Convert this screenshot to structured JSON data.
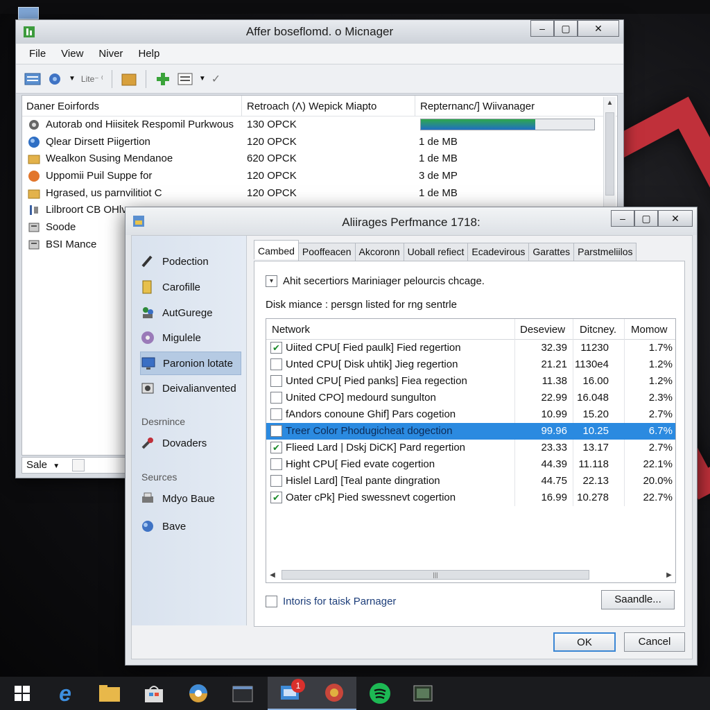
{
  "colors": {
    "accent": "#2b8ae0",
    "check": "#1b8a2a",
    "brand_red": "#c0303a",
    "taskbar": "#1a1b1e"
  },
  "main_window": {
    "title": "Affer boseflomd. o Micnager",
    "menu": [
      "File",
      "View",
      "Niver",
      "Help"
    ],
    "toolbar": {
      "text": "Lite⁻ ⁽"
    },
    "columns": [
      "Daner Eoirfords",
      "Retroach (Λ)  Wepick Miapto",
      "Repternanc/] Wiivanager"
    ],
    "rows": [
      {
        "icon": "gear-icon",
        "name": "Autorab ond Hiisitek Respomil Purkwous",
        "c2": "130 OPCK",
        "meter": 0.66
      },
      {
        "icon": "globe-icon",
        "name": "Qlear Dirsett Piigertion",
        "c2": "120 OPCK",
        "c3": "1 de MB"
      },
      {
        "icon": "folder-icon",
        "name": "Wealkon Susing Mendanoe",
        "c2": "620 OPCK",
        "c3": "1 de MB"
      },
      {
        "icon": "orange-circle-icon",
        "name": "Uppomii Puil Suppe for",
        "c2": "120 OPCK",
        "c3": "3 de MP"
      },
      {
        "icon": "folder-icon",
        "name": "Hgrased, us parnvilitiot C",
        "c2": "120 OPCK",
        "c3": "1 de MB"
      },
      {
        "icon": "tools-icon",
        "name": "Lilbroort CB OHlve",
        "c2": "",
        "c3": ""
      },
      {
        "icon": "drive-icon",
        "name": "Soode",
        "c2": "",
        "c3": ""
      },
      {
        "icon": "drive-icon",
        "name": "BSI Mance",
        "c2": "",
        "c3": ""
      }
    ],
    "status_label": "Sale"
  },
  "dialog": {
    "title": "Aliirages Perfmance 1718:",
    "sidebar": {
      "items": [
        {
          "icon": "pen-icon",
          "label": "Podection"
        },
        {
          "icon": "file-icon",
          "label": "Carofille"
        },
        {
          "icon": "people-icon",
          "label": "AutGurege"
        },
        {
          "icon": "disc-icon",
          "label": "Migulele"
        },
        {
          "icon": "monitor-icon",
          "label": "Paronion lotate"
        },
        {
          "icon": "device-icon",
          "label": "Deivalianvented"
        }
      ],
      "section1": "Desrnince",
      "section1_items": [
        {
          "icon": "wrench-icon",
          "label": "Dovaders"
        }
      ],
      "section2": "Seurces",
      "section2_items": [
        {
          "icon": "printer-icon",
          "label": "Mdyo Baue"
        },
        {
          "icon": "network-icon",
          "label": "Bave"
        }
      ]
    },
    "tabs": [
      "Cambed",
      "Pooffeacen",
      "Akcoronn",
      "Uoball refiect",
      "Ecadevirous",
      "Garattes",
      "Parstmeliilos"
    ],
    "option1": "Ahit secertiors Mariniager pelourcis chcage.",
    "option2": "Disk miance : persgn listed for rng sentrle",
    "grid_columns": [
      "Network",
      "Deseview",
      "Ditcney.",
      "Momow"
    ],
    "grid_rows": [
      {
        "checked": true,
        "name": "Uiited CPU[ Fied paulk] Fied regertion",
        "v1": "32.39",
        "v2": "11230",
        "v3": "1.7%"
      },
      {
        "checked": false,
        "name": "Unted CPU[ Disk uhtik] Jieg regertion",
        "v1": "21.21",
        "v2": "1130e4",
        "v3": "1.2%"
      },
      {
        "checked": false,
        "name": "Unted CPU[ Pied panks] Fiea regection",
        "v1": "11.38",
        "v2": "16.00",
        "v3": "1.2%"
      },
      {
        "checked": false,
        "name": "United CPO] medourd sungulton",
        "v1": "22.99",
        "v2": "16.048",
        "v3": "2.3%"
      },
      {
        "checked": false,
        "name": "fAndors conoune Ghif] Pars cogetion",
        "v1": "10.99",
        "v2": "15.20",
        "v3": "2.7%"
      },
      {
        "checked": false,
        "name": "Treer Color Phodugicheat dogection",
        "v1": "99.96",
        "v2": "10.25",
        "v3": "6.7%",
        "selected": true
      },
      {
        "checked": true,
        "name": "Flieed Lard | Dskj DiCK] Pard regertion",
        "v1": "23.33",
        "v2": "13.17",
        "v3": "2.7%"
      },
      {
        "checked": false,
        "name": "Hight CPU[ Fied evate cogertion",
        "v1": "44.39",
        "v2": "11.118",
        "v3": "22.1%"
      },
      {
        "checked": false,
        "name": "Hislel Lard] [Teal pante dingration",
        "v1": "44.75",
        "v2": "22.13",
        "v3": "20.0%"
      },
      {
        "checked": true,
        "name": "Oater cPk] Pied swessnevt cogertion",
        "v1": "16.99",
        "v2": "10.278",
        "v3": "22.7%"
      }
    ],
    "footer_option": "Intoris for taisk Parnager",
    "handle_button": "Saandle...",
    "ok": "OK",
    "cancel": "Cancel"
  },
  "taskbar": {
    "items": [
      "windows-start-icon",
      "edge-browser-icon",
      "file-explorer-icon",
      "store-icon",
      "chrome-icon",
      "terminal-icon",
      "app-window-icon",
      "chrome-active-icon",
      "spotify-icon",
      "media-icon"
    ],
    "badge": "1"
  }
}
